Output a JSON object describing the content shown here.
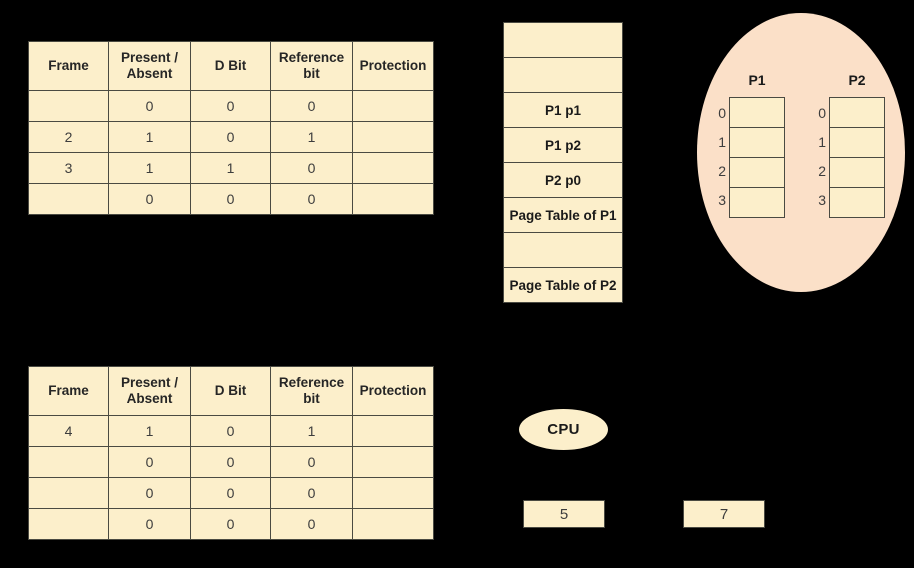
{
  "diagram": {
    "background_color": "#000000",
    "cell_fill_color": "#FCEFCB",
    "ellipse_fill_color": "#FBE0C8",
    "border_color": "#4A4A42"
  },
  "page_table_columns": [
    "Frame",
    "Present / Absent",
    "D Bit",
    "Reference bit",
    "Protection"
  ],
  "page_table_columns_lines": [
    [
      "Frame"
    ],
    [
      "Present /",
      "Absent"
    ],
    [
      "D Bit"
    ],
    [
      "Reference",
      "bit"
    ],
    [
      "Protection"
    ]
  ],
  "page_table_1": {
    "name": "page-table-1",
    "rows": [
      {
        "frame": "",
        "present_absent": "0",
        "d_bit": "0",
        "reference_bit": "0",
        "protection": ""
      },
      {
        "frame": "2",
        "present_absent": "1",
        "d_bit": "0",
        "reference_bit": "1",
        "protection": ""
      },
      {
        "frame": "3",
        "present_absent": "1",
        "d_bit": "1",
        "reference_bit": "0",
        "protection": ""
      },
      {
        "frame": "",
        "present_absent": "0",
        "d_bit": "0",
        "reference_bit": "0",
        "protection": ""
      }
    ]
  },
  "page_table_2": {
    "name": "page-table-2",
    "rows": [
      {
        "frame": "4",
        "present_absent": "1",
        "d_bit": "0",
        "reference_bit": "1",
        "protection": ""
      },
      {
        "frame": "",
        "present_absent": "0",
        "d_bit": "0",
        "reference_bit": "0",
        "protection": ""
      },
      {
        "frame": "",
        "present_absent": "0",
        "d_bit": "0",
        "reference_bit": "0",
        "protection": ""
      },
      {
        "frame": "",
        "present_absent": "0",
        "d_bit": "0",
        "reference_bit": "0",
        "protection": ""
      }
    ]
  },
  "memory_column": {
    "name": "main-memory-frames",
    "cells": [
      "",
      "",
      "P1 p1",
      "P1 p2",
      "P2 p0",
      "Page Table of P1",
      "",
      "Page Table of P2"
    ]
  },
  "process_area": {
    "processes": [
      {
        "title": "P1",
        "indices": [
          "0",
          "1",
          "2",
          "3"
        ],
        "entries": [
          "",
          "",
          "",
          ""
        ]
      },
      {
        "title": "P2",
        "indices": [
          "0",
          "1",
          "2",
          "3"
        ],
        "entries": [
          "",
          "",
          "",
          ""
        ]
      }
    ]
  },
  "cpu": {
    "label": "CPU"
  },
  "value_boxes": [
    {
      "name": "value-box-5",
      "value": "5"
    },
    {
      "name": "value-box-7",
      "value": "7"
    }
  ]
}
